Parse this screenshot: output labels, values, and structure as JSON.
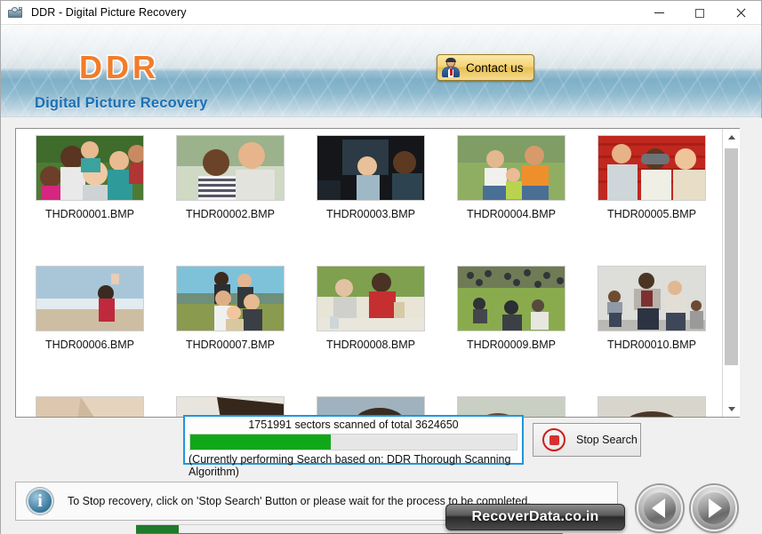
{
  "window": {
    "title": "DDR - Digital Picture Recovery",
    "icon": "camera-icon",
    "minimize_label": "Minimize",
    "maximize_label": "Maximize",
    "close_label": "Close"
  },
  "banner": {
    "logo": "DDR",
    "subtitle": "Digital Picture Recovery",
    "contact_button": "Contact us",
    "logo_color": "#f27c2a",
    "subtitle_color": "#1c6fb5"
  },
  "thumbnails": {
    "rows": [
      [
        {
          "file": "THDR00001.BMP"
        },
        {
          "file": "THDR00002.BMP"
        },
        {
          "file": "THDR00003.BMP"
        },
        {
          "file": "THDR00004.BMP"
        },
        {
          "file": "THDR00005.BMP"
        }
      ],
      [
        {
          "file": "THDR00006.BMP"
        },
        {
          "file": "THDR00007.BMP"
        },
        {
          "file": "THDR00008.BMP"
        },
        {
          "file": "THDR00009.BMP"
        },
        {
          "file": "THDR00010.BMP"
        }
      ]
    ]
  },
  "progress": {
    "status_text": "1751991 sectors scanned of total 3624650",
    "scanned": 1751991,
    "total": 3624650,
    "percent": 43,
    "note": "(Currently performing Search based on:  DDR Thorough Scanning Algorithm)",
    "fill_color": "#10a818",
    "border_color": "#1d96e0"
  },
  "stop": {
    "label": "Stop Search",
    "icon": "stop-icon",
    "color": "#d21a1a"
  },
  "info": {
    "icon": "info-icon",
    "glyph": "i",
    "message": "To Stop recovery, click on 'Stop Search' Button or please wait for the process to be completed."
  },
  "brand": {
    "text": "RecoverData.co.in"
  },
  "nav": {
    "back_label": "Back",
    "next_label": "Next"
  },
  "scrollbar": {
    "up_label": "Scroll up",
    "down_label": "Scroll down"
  }
}
